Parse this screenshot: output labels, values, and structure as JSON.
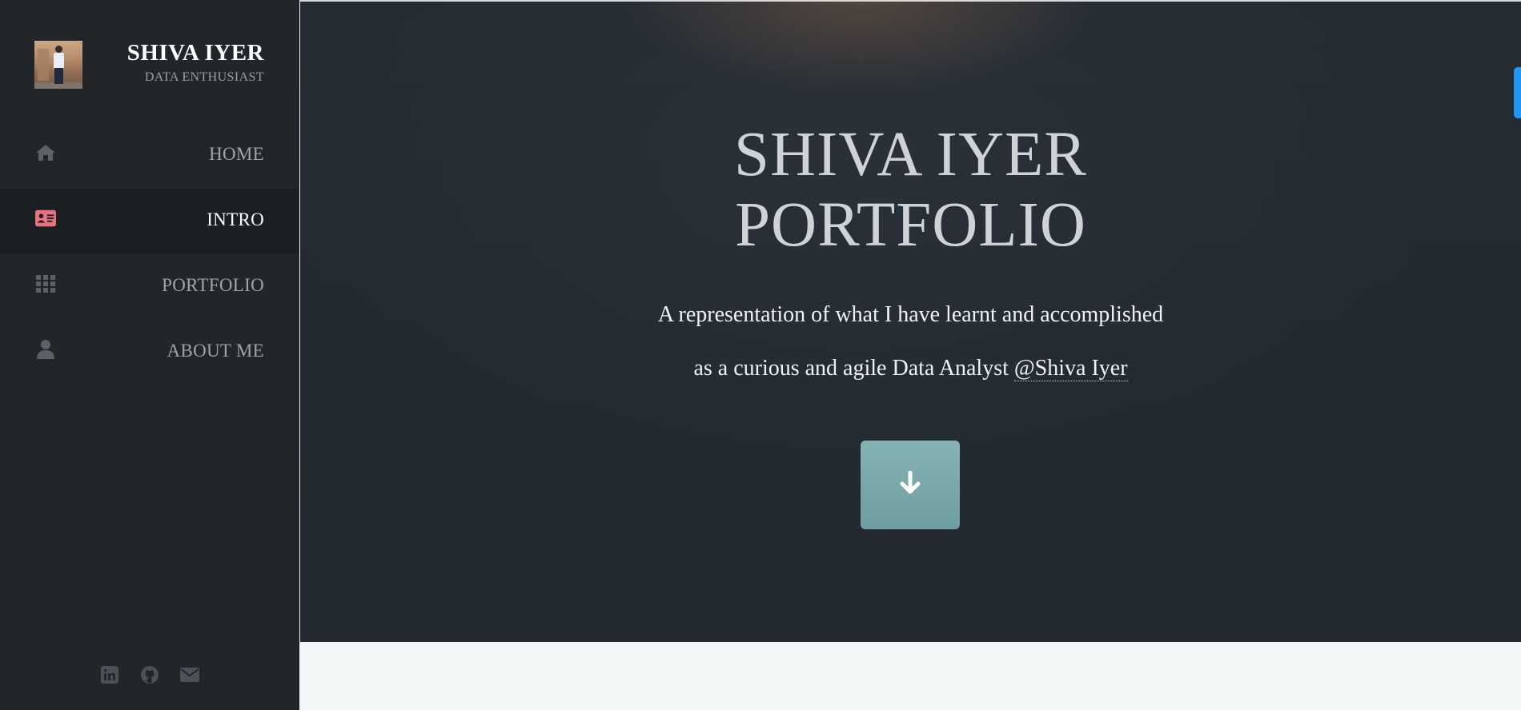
{
  "sidebar": {
    "brand_name": "SHIVA IYER",
    "brand_tagline": "DATA ENTHUSIAST",
    "nav": [
      {
        "label": "HOME",
        "icon": "home-icon",
        "active": false
      },
      {
        "label": "INTRO",
        "icon": "id-card-icon",
        "active": true
      },
      {
        "label": "PORTFOLIO",
        "icon": "grid-icon",
        "active": false
      },
      {
        "label": "ABOUT ME",
        "icon": "user-icon",
        "active": false
      }
    ],
    "social": [
      "linkedin-icon",
      "github-icon",
      "envelope-icon"
    ]
  },
  "hero": {
    "title_line1": "SHIVA IYER",
    "title_line2": "PORTFOLIO",
    "line1": "A representation of what I have learnt and accomplished",
    "line2_prefix": "as a curious and agile Data Analyst",
    "line2_link": "@Shiva Iyer",
    "button_icon": "arrow-down-icon"
  },
  "colors": {
    "sidebar_bg": "#222629",
    "active_icon": "#e8727f",
    "hero_button": "#7aa8aa",
    "scroll_tab": "#2196f3"
  }
}
